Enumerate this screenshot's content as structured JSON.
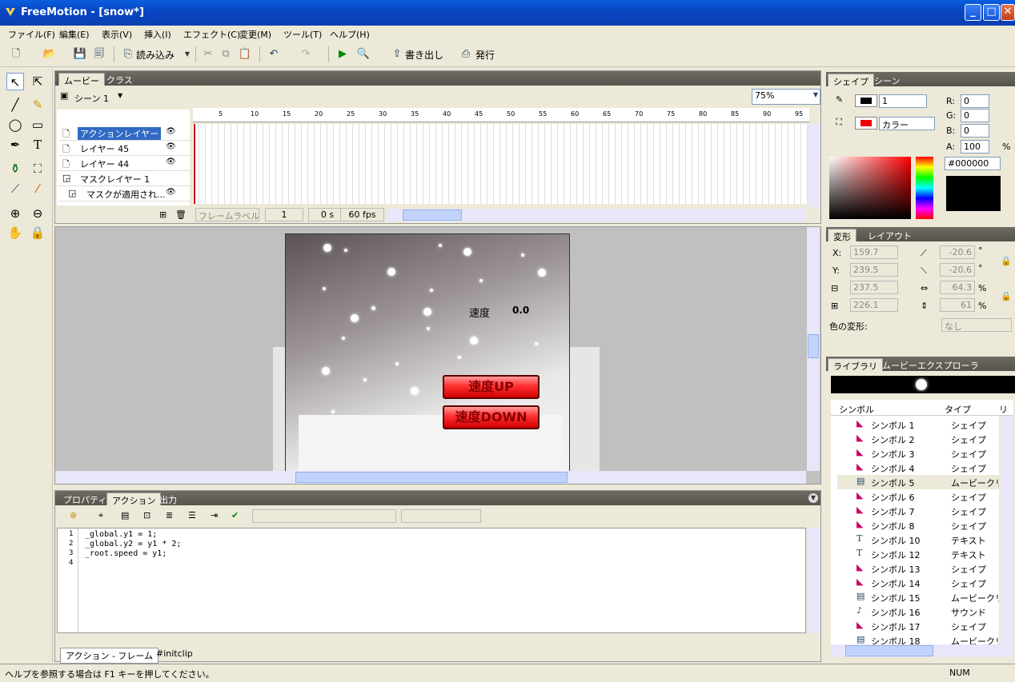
{
  "app": {
    "title": "FreeMotion - [snow*]"
  },
  "menu": [
    "ファイル(F)",
    "編集(E)",
    "表示(V)",
    "挿入(I)",
    "エフェクト(C)",
    "変更(M)",
    "ツール(T)",
    "ヘルプ(H)"
  ],
  "toolbar": {
    "import_label": "読み込み",
    "export_label": "書き出し",
    "publish_label": "発行"
  },
  "timeline": {
    "tabs": [
      "ムービー",
      "クラス"
    ],
    "scene_label": "シーン 1",
    "zoom": "75%",
    "layers": [
      "アクションレイヤー",
      "レイヤー 45",
      "レイヤー 44",
      "マスクレイヤー 1",
      "マスクが適用され..."
    ],
    "ruler_labels": [
      "5",
      "10",
      "15",
      "20",
      "25",
      "30",
      "35",
      "40",
      "45",
      "50",
      "55",
      "60",
      "65",
      "70",
      "75",
      "80",
      "85",
      "90",
      "95"
    ],
    "frame_label_placeholder": "フレームラベル",
    "current_frame": "1",
    "time": "0 s",
    "fps": "60 fps"
  },
  "stage": {
    "speed_label": "速度",
    "speed_value": "0.0",
    "btn_up": "速度UP",
    "btn_down": "速度DOWN"
  },
  "action_panel": {
    "tabs": [
      "プロパティ",
      "アクション",
      "出力"
    ],
    "code": [
      "_global.y1 = 1;",
      "_global.y2 = y1 * 2;",
      "_root.speed = y1;",
      ""
    ],
    "bottom_tabs": [
      "アクション - フレーム",
      "#initclip"
    ]
  },
  "shape_panel": {
    "tabs": [
      "シェイプ",
      "シーン"
    ],
    "stroke_width": "1",
    "fill_type": "カラー",
    "r_label": "R:",
    "g_label": "G:",
    "b_label": "B:",
    "a_label": "A:",
    "r": "0",
    "g": "0",
    "b": "0",
    "a": "100",
    "percent": "%",
    "hex": "#000000"
  },
  "transform_panel": {
    "tabs": [
      "変形",
      "レイアウト"
    ],
    "x_label": "X:",
    "y_label": "Y:",
    "x": "159.7",
    "y": "239.5",
    "w": "237.5",
    "h": "226.1",
    "rot1": "-20.6",
    "rot2": "-20.6",
    "scale_w": "64.3",
    "scale_h": "61",
    "deg": "°",
    "percent": "%",
    "color_transform_label": "色の変形:",
    "color_transform_value": "なし"
  },
  "library": {
    "tabs": [
      "ライブラリ",
      "ムービーエクスプローラ"
    ],
    "col_symbol": "シンボル",
    "col_type": "タイプ",
    "col_link": "リン",
    "items": [
      {
        "name": "シンボル 1",
        "type": "シェイプ",
        "icon": "shape"
      },
      {
        "name": "シンボル 2",
        "type": "シェイプ",
        "icon": "shape"
      },
      {
        "name": "シンボル 3",
        "type": "シェイプ",
        "icon": "shape"
      },
      {
        "name": "シンボル 4",
        "type": "シェイプ",
        "icon": "shape"
      },
      {
        "name": "シンボル 5",
        "type": "ムービークリッ...",
        "icon": "movie"
      },
      {
        "name": "シンボル 6",
        "type": "シェイプ",
        "icon": "shape"
      },
      {
        "name": "シンボル 7",
        "type": "シェイプ",
        "icon": "shape"
      },
      {
        "name": "シンボル 8",
        "type": "シェイプ",
        "icon": "shape"
      },
      {
        "name": "シンボル 10",
        "type": "テキスト",
        "icon": "text"
      },
      {
        "name": "シンボル 12",
        "type": "テキスト",
        "icon": "text"
      },
      {
        "name": "シンボル 13",
        "type": "シェイプ",
        "icon": "shape"
      },
      {
        "name": "シンボル 14",
        "type": "シェイプ",
        "icon": "shape"
      },
      {
        "name": "シンボル 15",
        "type": "ムービークリッ...",
        "icon": "movie"
      },
      {
        "name": "シンボル 16",
        "type": "サウンド",
        "icon": "sound"
      },
      {
        "name": "シンボル 17",
        "type": "シェイプ",
        "icon": "shape"
      },
      {
        "name": "シンボル 18",
        "type": "ムービークリッ...",
        "icon": "movie"
      }
    ]
  },
  "status": {
    "help": "ヘルプを参照する場合は F1 キーを押してください。",
    "num": "NUM"
  }
}
